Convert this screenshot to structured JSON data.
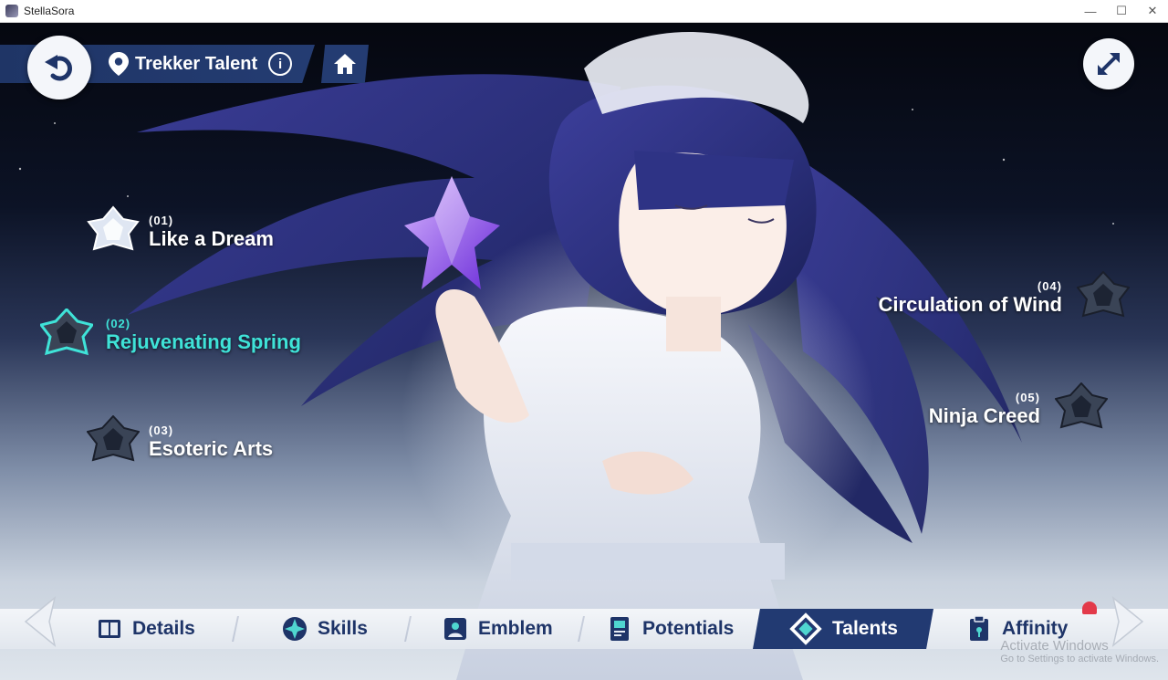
{
  "window": {
    "title": "StellaSora",
    "controls": [
      "—",
      "☐",
      "✕"
    ]
  },
  "header": {
    "location_title": "Trekker Talent"
  },
  "talents": [
    {
      "number": "(01)",
      "name": "Like a Dream"
    },
    {
      "number": "(02)",
      "name": "Rejuvenating Spring"
    },
    {
      "number": "(03)",
      "name": "Esoteric Arts"
    },
    {
      "number": "(04)",
      "name": "Circulation of Wind"
    },
    {
      "number": "(05)",
      "name": "Ninja Creed"
    }
  ],
  "active_talent": "Rejuvenating Spring",
  "tabs": [
    {
      "label": "Details",
      "icon": "book-icon"
    },
    {
      "label": "Skills",
      "icon": "star-compass-icon"
    },
    {
      "label": "Emblem",
      "icon": "portrait-icon"
    },
    {
      "label": "Potentials",
      "icon": "potential-card-icon"
    },
    {
      "label": "Talents",
      "icon": "talent-diamond-icon"
    },
    {
      "label": "Affinity",
      "icon": "clipboard-icon"
    }
  ],
  "active_tab": "Talents",
  "watermark": {
    "line1": "Activate Windows",
    "line2": "Go to Settings to activate Windows."
  },
  "colors": {
    "accent_teal": "#3fe3d8",
    "navy": "#223a72",
    "notification": "#e33a4a"
  }
}
